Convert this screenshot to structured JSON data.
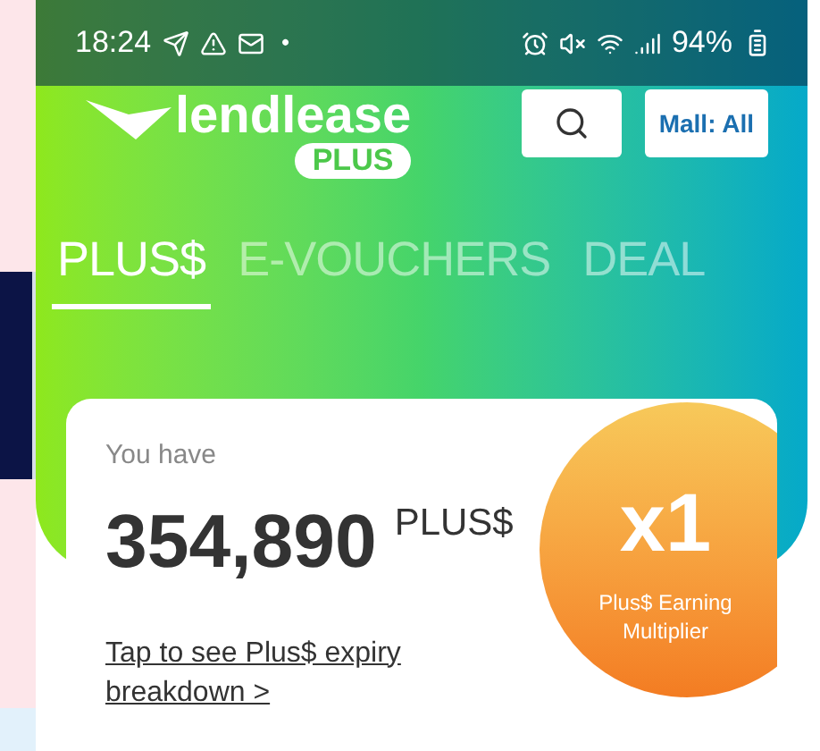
{
  "status_bar": {
    "time": "18:24",
    "notification_dot": "•",
    "battery": "94%"
  },
  "header": {
    "logo_text": "lendlease",
    "logo_badge": "PLUS",
    "mall_button": "Mall: All"
  },
  "tabs": [
    {
      "label": "PLUS$",
      "selected": true
    },
    {
      "label": "E-VOUCHERS",
      "selected": false
    },
    {
      "label": "DEAL",
      "selected": false
    }
  ],
  "card": {
    "label": "You have",
    "amount": "354,890",
    "unit": "PLUS$",
    "link": "Tap to see Plus$ expiry breakdown >",
    "multiplier": "x1",
    "multiplier_label": "Plus$ Earning Multiplier"
  }
}
